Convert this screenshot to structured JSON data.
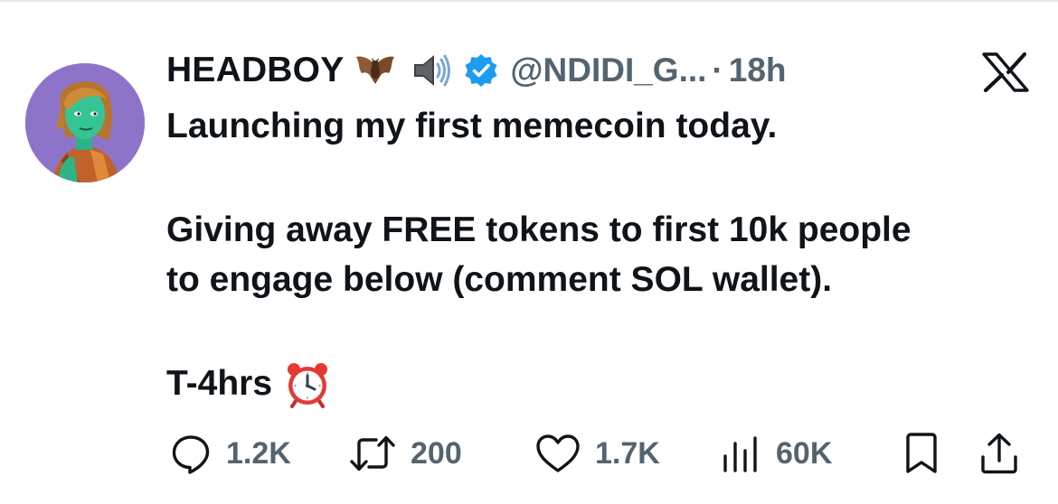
{
  "tweet": {
    "display_name": "HEADBOY",
    "name_emojis": [
      "bat-icon",
      "speaker-icon"
    ],
    "verified": true,
    "handle": "@NDIDI_G...",
    "separator": "·",
    "time": "18h",
    "platform_icon": "x-logo-icon",
    "text_lines": [
      "Launching my first memecoin today.",
      "Giving away FREE tokens to first 10k people",
      "to engage below (comment SOL wallet).",
      "T-4hrs"
    ],
    "trailing_emoji": "alarm-clock-icon"
  },
  "actions": {
    "replies": "1.2K",
    "reposts": "200",
    "likes": "1.7K",
    "views": "60K"
  },
  "colors": {
    "text": "#0f1419",
    "secondary": "#536471",
    "verified": "#1d9bf0",
    "avatar_bg": "#8e74c9"
  }
}
